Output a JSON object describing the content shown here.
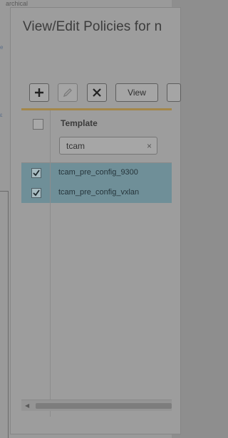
{
  "background": {
    "top_text": "archical"
  },
  "modal": {
    "title": "View/Edit Policies for n"
  },
  "toolbar": {
    "add_icon": "plus-icon",
    "edit_icon": "pencil-icon",
    "delete_icon": "close-icon",
    "view_label": "View"
  },
  "table": {
    "header": "Template",
    "filter_value": "tcam",
    "filter_clear_glyph": "×",
    "rows": [
      {
        "name": "tcam_pre_config_9300",
        "checked": true
      },
      {
        "name": "tcam_pre_config_vxlan",
        "checked": true
      }
    ]
  },
  "colors": {
    "accent": "#a3874a",
    "selected_row": "#6f8f98"
  }
}
